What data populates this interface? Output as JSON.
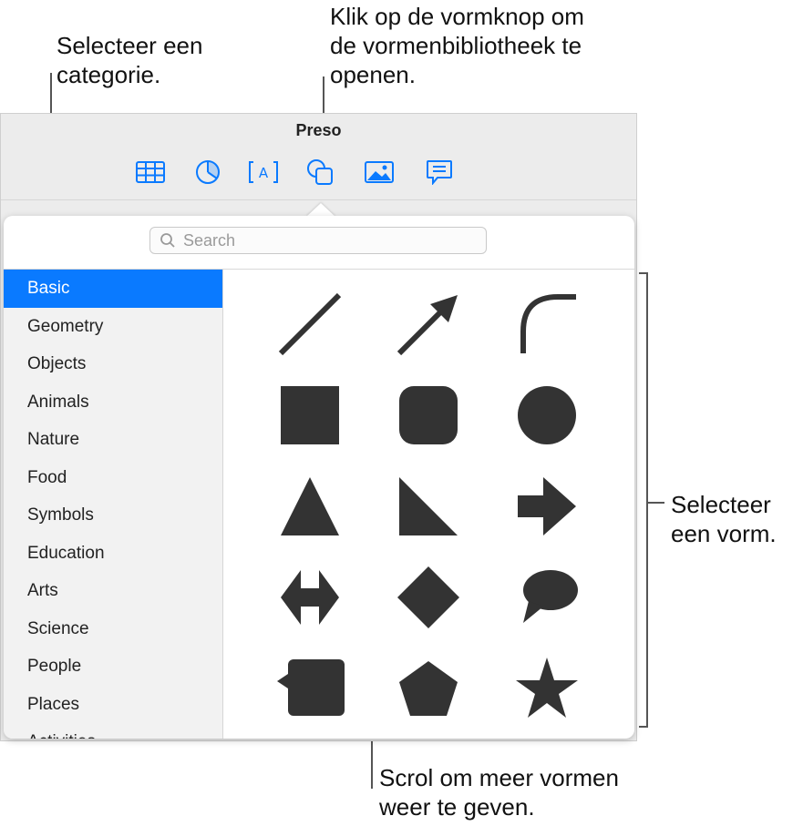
{
  "callouts": {
    "category": "Selecteer een\ncategorie.",
    "shape_button": "Klik op de vormknop om\nde vormenbibliotheek te\nopenen.",
    "select_shape": "Selecteer\neen vorm.",
    "scroll": "Scrol om meer vormen\nweer te geven."
  },
  "window": {
    "title": "Preso",
    "toolbar": [
      {
        "icon": "table-icon"
      },
      {
        "icon": "chart-icon"
      },
      {
        "icon": "text-box-icon"
      },
      {
        "icon": "shape-icon"
      },
      {
        "icon": "media-icon"
      },
      {
        "icon": "comment-icon"
      }
    ]
  },
  "search": {
    "placeholder": "Search",
    "value": ""
  },
  "categories": [
    "Basic",
    "Geometry",
    "Objects",
    "Animals",
    "Nature",
    "Food",
    "Symbols",
    "Education",
    "Arts",
    "Science",
    "People",
    "Places",
    "Activities"
  ],
  "selected_category": "Basic",
  "shapes": [
    "line",
    "arrow",
    "curve",
    "square",
    "rounded-square",
    "circle",
    "triangle",
    "right-triangle",
    "right-arrow",
    "double-arrow",
    "diamond",
    "speech-bubble",
    "callout-square",
    "pentagon",
    "star"
  ],
  "colors": {
    "accent": "#0a7aff",
    "shape_fill": "#333333"
  }
}
